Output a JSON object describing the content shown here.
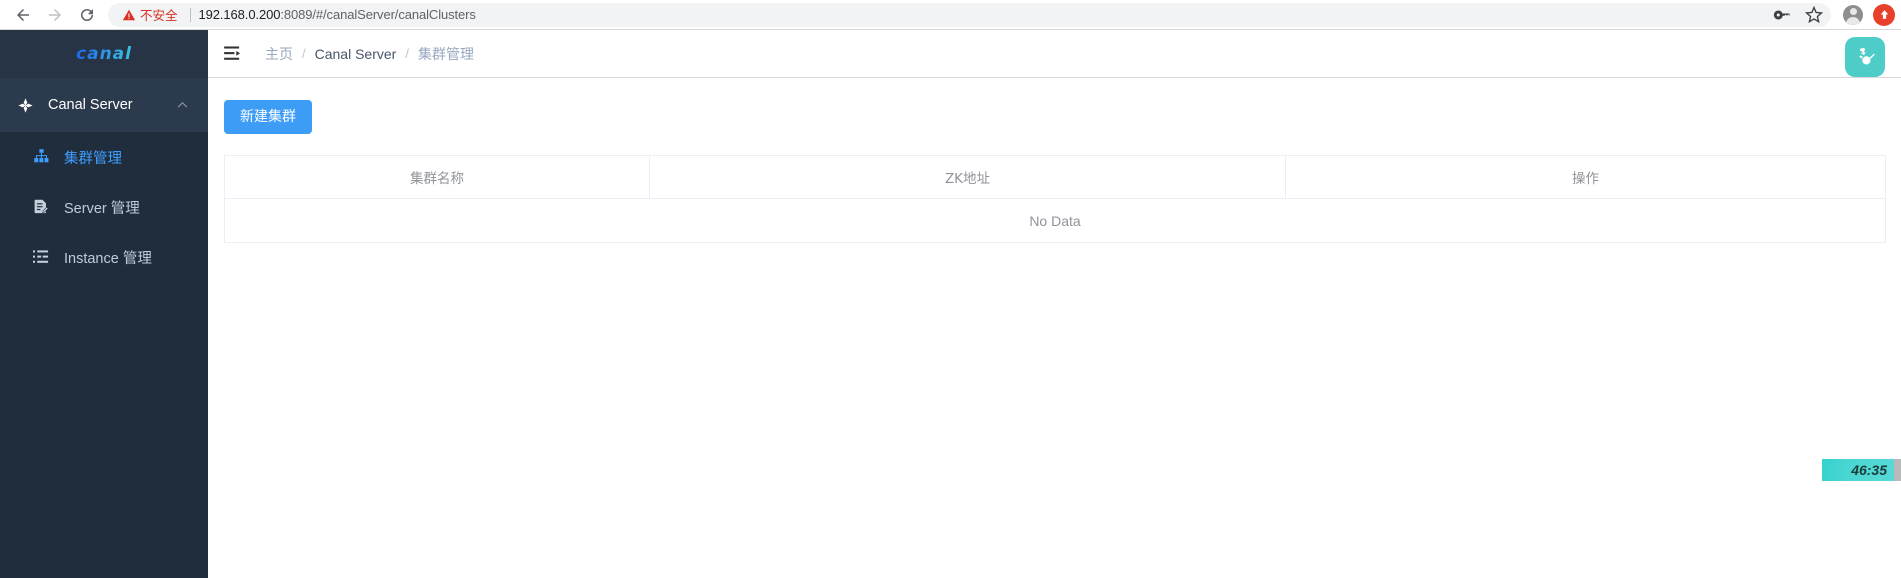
{
  "browser": {
    "back_icon": "back-arrow-icon",
    "forward_icon": "forward-arrow-icon",
    "reload_icon": "reload-icon",
    "security_label": "不安全",
    "url_host": "192.168.0.200",
    "url_rest": ":8089/#/canalServer/canalClusters",
    "key_icon": "password-key-icon",
    "bookmark_icon": "star-icon",
    "profile_icon": "avatar-icon",
    "update_icon": "update-arrow-icon"
  },
  "sidebar": {
    "logo": "canal",
    "group": {
      "label": "Canal Server",
      "icon": "compass-icon",
      "chevron": "⌃"
    },
    "items": [
      {
        "label": "集群管理",
        "icon": "sitemap-icon",
        "active": true
      },
      {
        "label": "Server 管理",
        "icon": "document-edit-icon",
        "active": false
      },
      {
        "label": "Instance 管理",
        "icon": "list-table-icon",
        "active": false
      }
    ]
  },
  "topbar": {
    "menu_toggle_icon": "hamburger-collapse-icon",
    "breadcrumb": [
      {
        "label": "主页",
        "current": false
      },
      {
        "label": "Canal Server",
        "current": false
      },
      {
        "label": "集群管理",
        "current": true
      }
    ],
    "separator": "/",
    "app_badge_icon": "mascot-icon",
    "accent_color": "#4ecdc8"
  },
  "main": {
    "new_cluster_button": "新建集群",
    "table": {
      "columns": [
        "集群名称",
        "ZK地址",
        "操作"
      ],
      "rows": [],
      "empty_text": "No Data"
    }
  },
  "overlay": {
    "recording_timer": "46:35"
  },
  "colors": {
    "primary": "#3d9cf5",
    "sidebar_bg": "#1f2d3d",
    "sidebar_group_bg": "#2b3a4d",
    "active_menu": "#409eff",
    "badge_teal": "#4ecdc8",
    "warning_red": "#d93025"
  }
}
